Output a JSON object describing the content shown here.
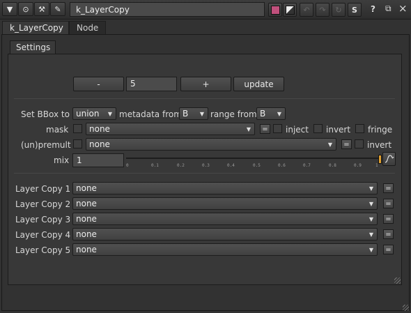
{
  "window": {
    "node_name": "k_LayerCopy",
    "icons": [
      "collapse-arrow-icon",
      "node-circle-icon",
      "tools-icon",
      "wrench-icon"
    ],
    "right_buttons": {
      "color_swatch": "#c0507c",
      "help": "?",
      "float": "⧉",
      "close": "×",
      "s_label": "S"
    }
  },
  "tabs": [
    {
      "label": "k_LayerCopy",
      "active": true
    },
    {
      "label": "Node",
      "active": false
    }
  ],
  "subtab": {
    "label": "Settings"
  },
  "top_controls": {
    "minus": "-",
    "count": "5",
    "plus": "+",
    "update": "update"
  },
  "bbox": {
    "label": "Set BBox to",
    "value": "union",
    "metadata_label": "metadata from",
    "metadata_value": "B",
    "range_label": "range from",
    "range_value": "B"
  },
  "mask": {
    "label": "mask",
    "value": "none",
    "eq": "=",
    "inject": "inject",
    "invert": "invert",
    "fringe": "fringe"
  },
  "premult": {
    "label": "(un)premult",
    "value": "none",
    "eq": "=",
    "invert": "invert"
  },
  "mix": {
    "label": "mix",
    "value": "1",
    "ticks": [
      "0",
      "0.1",
      "0.2",
      "0.3",
      "0.4",
      "0.5",
      "0.6",
      "0.7",
      "0.8",
      "0.9",
      "1"
    ]
  },
  "layers": [
    {
      "label": "Layer Copy 1",
      "value": "none",
      "eq": "="
    },
    {
      "label": "Layer Copy 2",
      "value": "none",
      "eq": "="
    },
    {
      "label": "Layer Copy 3",
      "value": "none",
      "eq": "="
    },
    {
      "label": "Layer Copy 4",
      "value": "none",
      "eq": "="
    },
    {
      "label": "Layer Copy 5",
      "value": "none",
      "eq": "="
    }
  ]
}
